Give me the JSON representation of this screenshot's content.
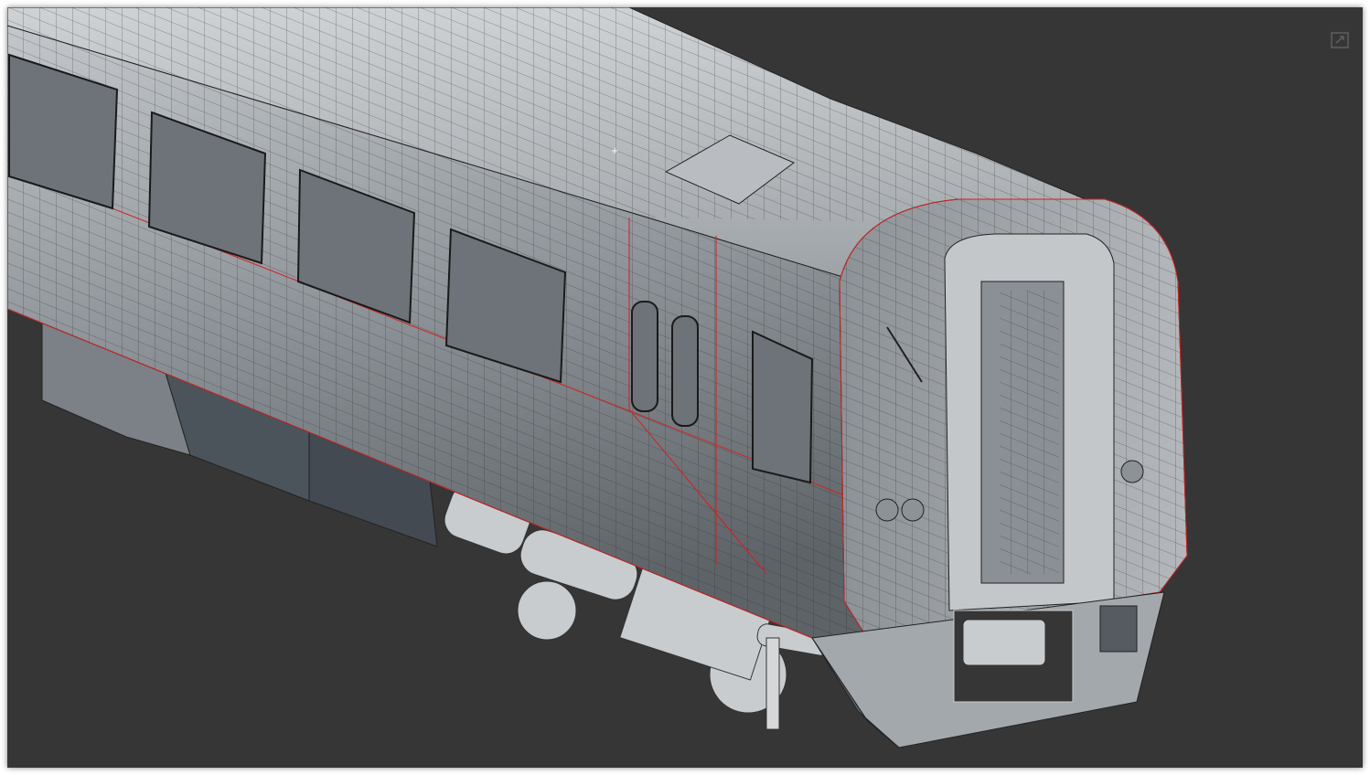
{
  "viewport": {
    "background_color": "#363636",
    "model_color": "#9aa0a5",
    "edge_color": "#1e1e1e",
    "seam_color": "#d42020",
    "icons": [
      "maximize-viewport-icon",
      "viewport-origin-icon"
    ]
  }
}
